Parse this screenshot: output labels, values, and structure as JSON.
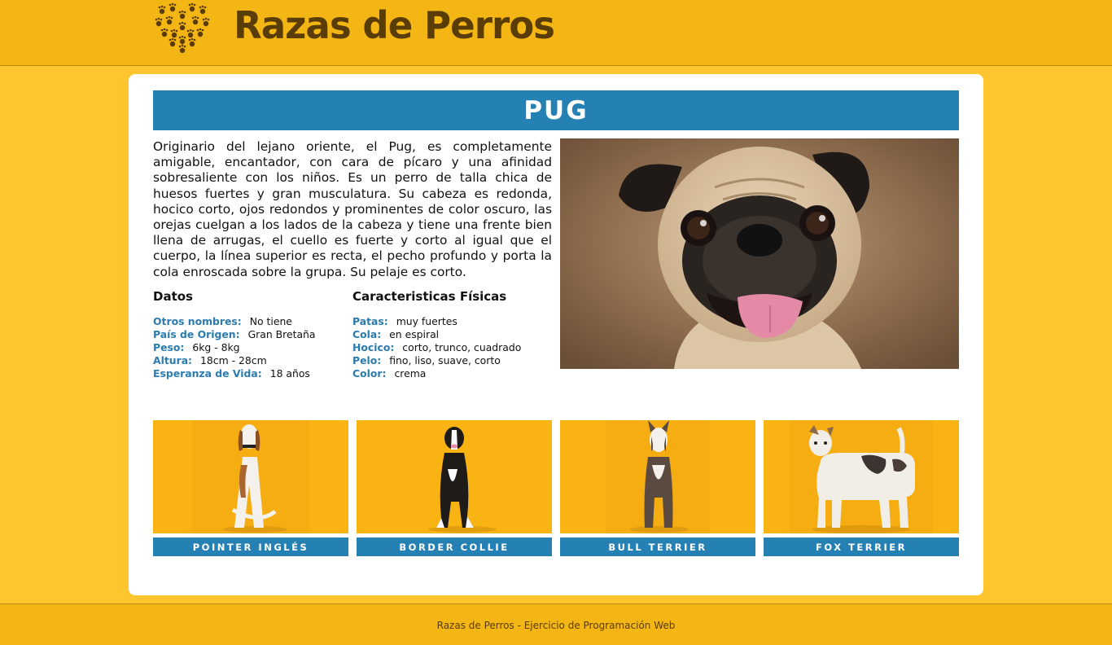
{
  "header": {
    "title": "Razas de Perros",
    "logo_icon": "heart-paw-icon"
  },
  "breed": {
    "name": "PUG",
    "description": "Originario del lejano oriente, el Pug, es completamente amigable, encantador, con cara de pícaro y una afinidad sobresaliente con los niños. Es un perro de talla chica de huesos fuertes y gran musculatura. Su cabeza es redonda, hocico corto, ojos redondos y prominentes de color oscuro, las orejas cuelgan a los lados de la cabeza y tiene una frente bien llena de arrugas, el cuello es fuerte y corto al igual que el cuerpo, la línea superior es recta, el pecho profundo y porta la cola enroscada sobre la grupa. Su pelaje es corto.",
    "datos": {
      "heading": "Datos",
      "rows": [
        {
          "key": "Otros nombres:",
          "value": "No tiene"
        },
        {
          "key": "País de Origen:",
          "value": "Gran Bretaña"
        },
        {
          "key": "Peso:",
          "value": "6kg - 8kg"
        },
        {
          "key": "Altura:",
          "value": "18cm - 28cm"
        },
        {
          "key": "Esperanza de Vida:",
          "value": "18 años"
        }
      ]
    },
    "fisicas": {
      "heading": "Caracteristicas Físicas",
      "rows": [
        {
          "key": "Patas:",
          "value": "muy fuertes"
        },
        {
          "key": "Cola:",
          "value": "en espiral"
        },
        {
          "key": "Hocico:",
          "value": "corto, trunco, cuadrado"
        },
        {
          "key": "Pelo:",
          "value": "fino, liso, suave, corto"
        },
        {
          "key": "Color:",
          "value": "crema"
        }
      ]
    }
  },
  "gallery": [
    {
      "label": "POINTER INGLÉS"
    },
    {
      "label": "BORDER COLLIE"
    },
    {
      "label": "BULL TERRIER"
    },
    {
      "label": "FOX TERRIER"
    }
  ],
  "footer": {
    "text": "Razas de Perros - Ejercicio de Programación Web"
  },
  "colors": {
    "page_bg": "#fec52e",
    "header_bg": "#f3b614",
    "accent_blue": "#2580b3",
    "label_blue": "#2a7bb0",
    "logo_brown": "#5a3d06"
  }
}
